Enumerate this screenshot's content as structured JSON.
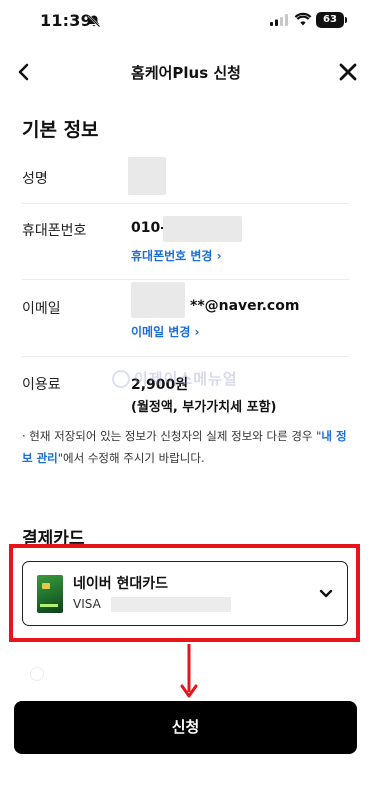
{
  "status_bar": {
    "time": "11:39",
    "battery": "63"
  },
  "nav": {
    "title": "홈케어Plus 신청"
  },
  "basic_info": {
    "title": "기본 정보",
    "name_label": "성명",
    "phone_label": "휴대폰번호",
    "phone_prefix": "010-",
    "phone_change": "휴대폰번호 변경 ›",
    "email_label": "이메일",
    "email_suffix": "**@naver.com",
    "email_change": "이메일 변경 ›",
    "fee_label": "이용료",
    "fee_amount": "2,900원",
    "fee_note": "(월정액, 부가가치세 포함)"
  },
  "notice": {
    "text_before": "· 현재 저장되어 있는 정보가 신청자의 실제 정보와 다른 경우 \"",
    "link": "내 정보 관리",
    "text_after": "\"에서 수정해 주시기 바랍니다."
  },
  "payment": {
    "title": "결제카드",
    "card_name": "네이버 현대카드",
    "card_brand": "VISA"
  },
  "watermark": "이제이스메뉴얼",
  "submit": {
    "label": "신청"
  },
  "colors": {
    "accent_link": "#1a6fd6",
    "highlight": "#e8141b",
    "button_bg": "#000000"
  }
}
